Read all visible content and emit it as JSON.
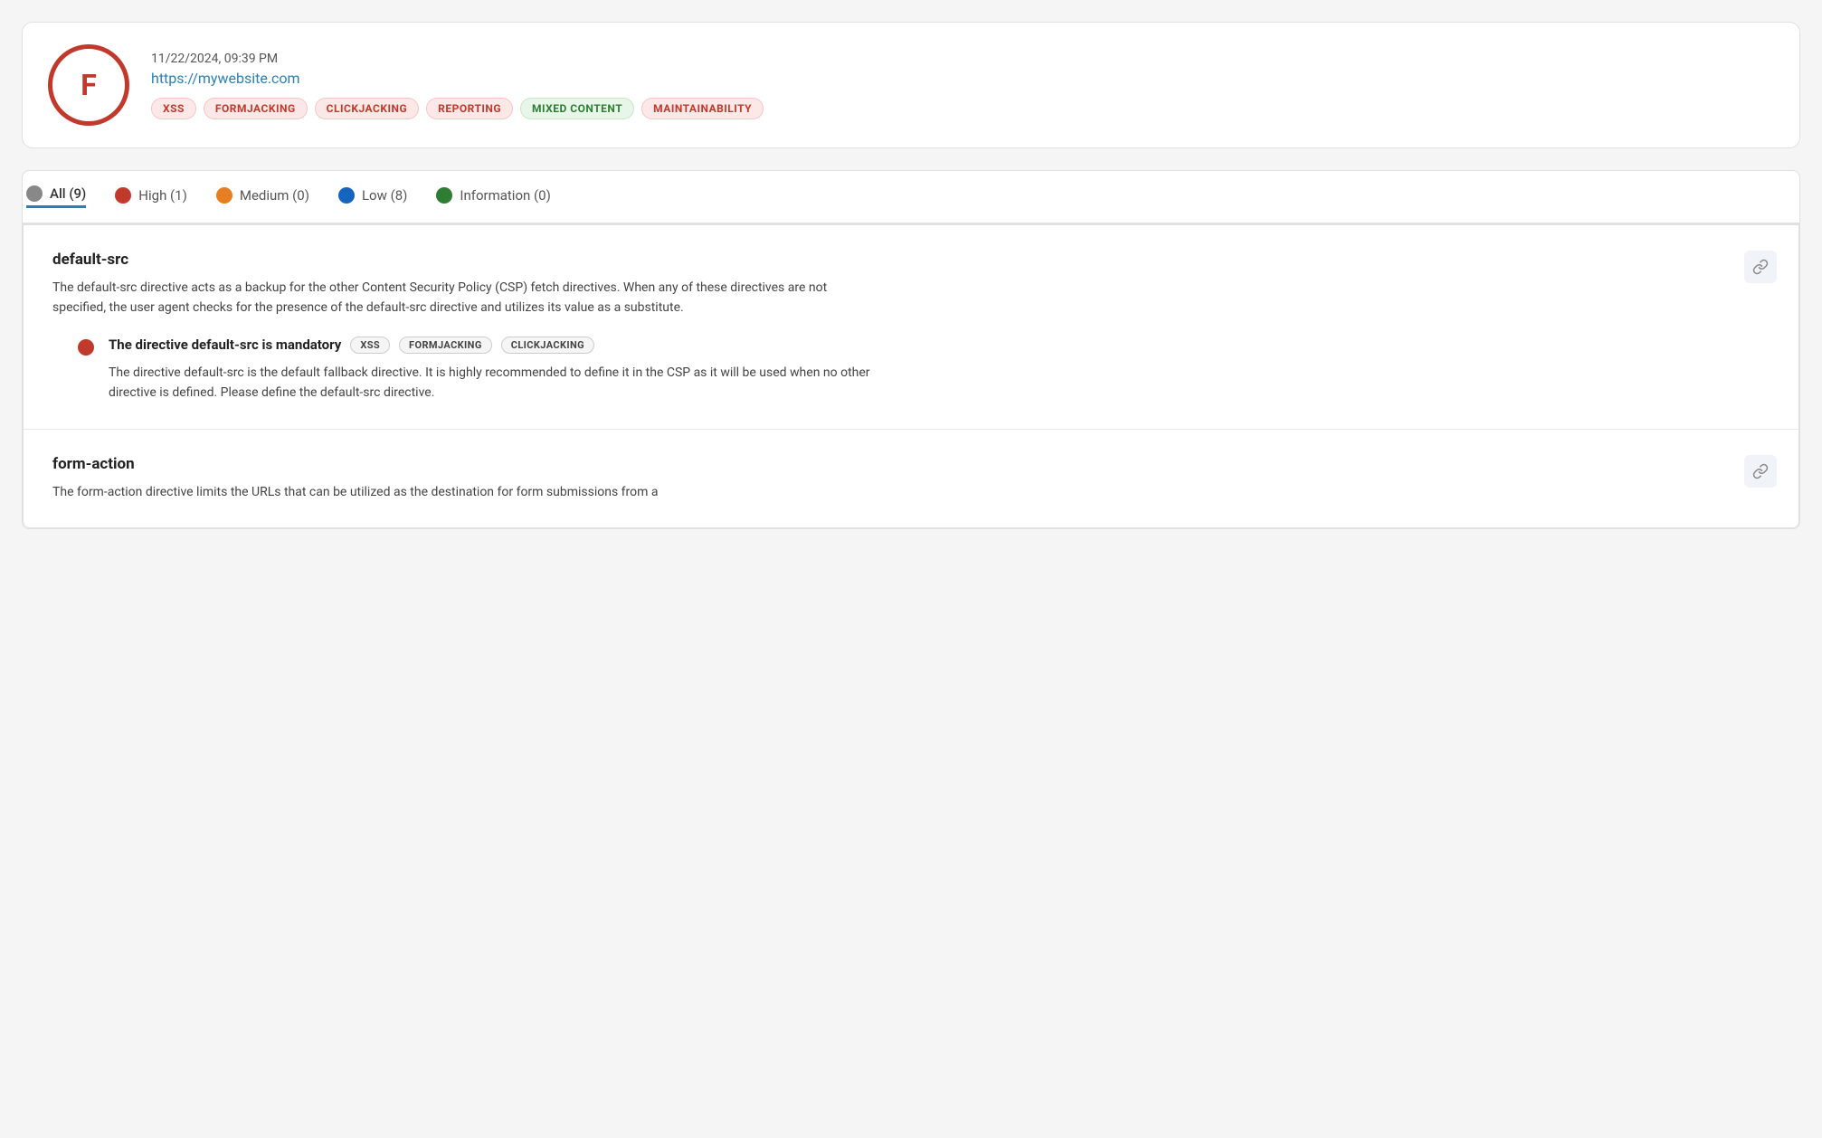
{
  "header": {
    "grade": "F",
    "timestamp": "11/22/2024, 09:39 PM",
    "url": "https://mywebsite.com",
    "tags": [
      {
        "label": "XSS",
        "style": "red"
      },
      {
        "label": "FORMJACKING",
        "style": "red"
      },
      {
        "label": "CLICKJACKING",
        "style": "red"
      },
      {
        "label": "REPORTING",
        "style": "red"
      },
      {
        "label": "MIXED CONTENT",
        "style": "green"
      },
      {
        "label": "MAINTAINABILITY",
        "style": "red"
      }
    ]
  },
  "filters": [
    {
      "id": "all",
      "label": "All (9)",
      "dot": "gray",
      "active": true
    },
    {
      "id": "high",
      "label": "High (1)",
      "dot": "red",
      "active": false
    },
    {
      "id": "medium",
      "label": "Medium (0)",
      "dot": "orange",
      "active": false
    },
    {
      "id": "low",
      "label": "Low (8)",
      "dot": "blue",
      "active": false
    },
    {
      "id": "information",
      "label": "Information (0)",
      "dot": "green",
      "active": false
    }
  ],
  "directives": [
    {
      "id": "default-src",
      "title": "default-src",
      "description": "The default-src directive acts as a backup for the other Content Security Policy (CSP) fetch directives. When any of these directives are not specified, the user agent checks for the presence of the default-src directive and utilizes its value as a substitute.",
      "findings": [
        {
          "severity": "high",
          "title": "The directive default-src is mandatory",
          "tags": [
            "XSS",
            "FORMJACKING",
            "CLICKJACKING"
          ],
          "description": "The directive default-src is the default fallback directive. It is highly recommended to define it in the CSP as it will be used when no other directive is defined. Please define the default-src directive."
        }
      ]
    },
    {
      "id": "form-action",
      "title": "form-action",
      "description": "The form-action directive limits the URLs that can be utilized as the destination for form submissions from a",
      "findings": []
    }
  ],
  "icons": {
    "link": "🔗"
  }
}
